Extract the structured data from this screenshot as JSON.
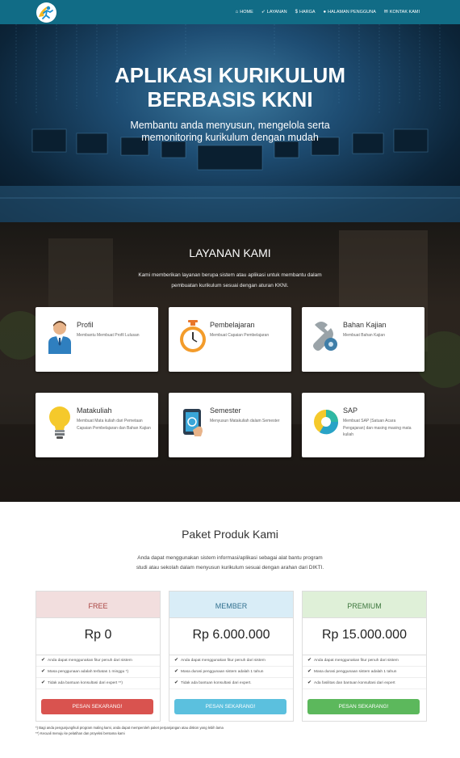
{
  "nav": {
    "logo_icon": "runner-logo-icon",
    "items": [
      {
        "icon": "home-icon",
        "glyph": "⌂",
        "label": "HOME"
      },
      {
        "icon": "rocket-icon",
        "glyph": "➶",
        "label": "LAYANAN"
      },
      {
        "icon": "dollar-icon",
        "glyph": "$",
        "label": "HARGA"
      },
      {
        "icon": "user-icon",
        "glyph": "●",
        "label": "HALAMAN PENGGUNA"
      },
      {
        "icon": "envelope-icon",
        "glyph": "✉",
        "label": "KONTAK KAMI"
      }
    ]
  },
  "hero": {
    "title_line1": "APLIKASI KURIKULUM",
    "title_line2": "BERBASIS KKNI",
    "subtitle_line1": "Membantu anda menyusun, mengelola serta",
    "subtitle_line2": "memonitoring kurikulum dengan mudah"
  },
  "services": {
    "title": "LAYANAN KAMI",
    "desc_line1": "Kami memberikan layanan berupa sistem atau aplikasi untuk membantu dalam",
    "desc_line2": "pembuatan kurikulum sesuai dengan aturan KKNI.",
    "cards": [
      {
        "title": "Profil",
        "desc": "Membantu Membuat Profil Lulusan",
        "icon": "person-icon"
      },
      {
        "title": "Pembelajaran",
        "desc": "Membuat Capaian Pembelajaran",
        "icon": "stopwatch-icon"
      },
      {
        "title": "Bahan Kajian",
        "desc": "Membuat Bahan Kajian",
        "icon": "wrench-icon"
      },
      {
        "title": "Matakuliah",
        "desc": "Membuat Mata kuliah dari Pemetaan Capaian Pembelajaran dan Bahan Kajian",
        "icon": "lightbulb-icon"
      },
      {
        "title": "Semester",
        "desc": "Menyusun Matakuliah dalam Semester",
        "icon": "tablet-icon"
      },
      {
        "title": "SAP",
        "desc": "Membuat SAP (Satuan Acara Pengajaran) dan masing masing mata kuliah",
        "icon": "pie-chart-icon"
      }
    ]
  },
  "pricing": {
    "title": "Paket Produk Kami",
    "desc_line1": "Anda dapat menggunakan sistem informasi/aplikasi sebagai alat bantu program",
    "desc_line2": "studi atau sekolah dalam menyusun kurikulum sesuai dengan arahan dari DIKTI.",
    "check_glyph": "✔",
    "plans": [
      {
        "name": "FREE",
        "price": "Rp 0",
        "head_bg": "#f2dede",
        "head_color": "#a94442",
        "btn_color": "#d9534f",
        "features": [
          "Anda dapat menggunakan fitur penuh dari sistem",
          "Masa penggunaan adalah terbatas 1 minggu *)",
          "Tidak ada bantuan konsultasi dari expert **)"
        ],
        "button": "PESAN SEKARANG!"
      },
      {
        "name": "MEMBER",
        "price": "Rp 6.000.000",
        "head_bg": "#d9edf7",
        "head_color": "#31708f",
        "btn_color": "#5bc0de",
        "features": [
          "Anda dapat menggunakan fitur penuh dari sistem",
          "Masa durasi penggunaan sistem adalah 1 tahun",
          "Tidak ada bantuan konsultasi dari expert."
        ],
        "button": "PESAN SEKARANG!"
      },
      {
        "name": "PREMIUM",
        "price": "Rp 15.000.000",
        "head_bg": "#dff0d8",
        "head_color": "#3c763d",
        "btn_color": "#5cb85c",
        "features": [
          "Anda dapat menggunakan fitur penuh dari sistem",
          "Masa durasi penggunaan sistem adalah 1 tahun",
          "Ada fasilitas dan bantuan konsultasi dari expert"
        ],
        "button": "PESAN SEKARANG!"
      }
    ],
    "note1": "*) Bagi anda pengunjung/kuli program maling kami, anda dapat memperoleh paket perpanjangan atau diskon yang lebih lama",
    "note2": "**) Kecuali menuju ke pelatihan dan proyeksi bersama kami"
  }
}
